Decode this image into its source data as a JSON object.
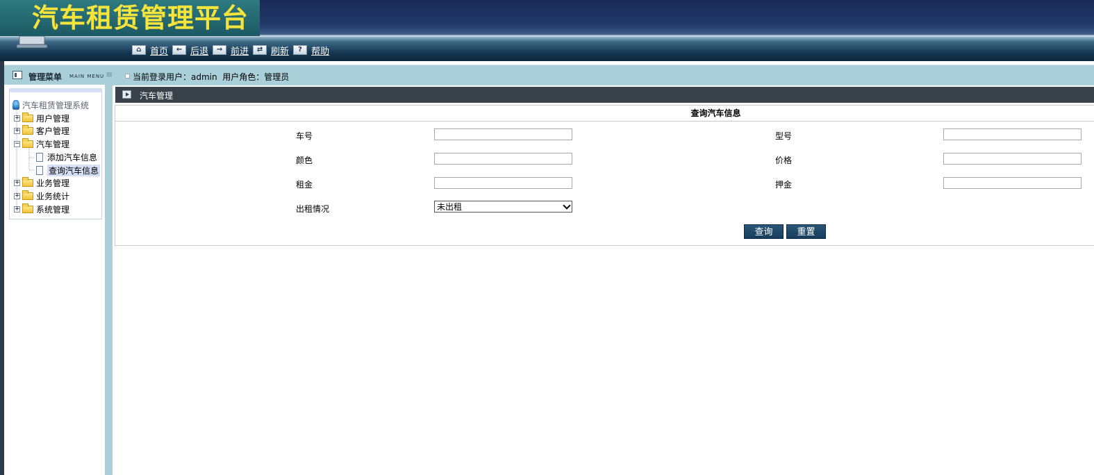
{
  "header": {
    "app_title": "汽车租赁管理平台"
  },
  "toolbar": {
    "items": [
      {
        "icon": "home-icon",
        "label": "首页"
      },
      {
        "icon": "back-arrow-icon",
        "label": "后退"
      },
      {
        "icon": "forward-arrow-icon",
        "label": "前进"
      },
      {
        "icon": "refresh-icon",
        "label": "刷新"
      },
      {
        "icon": "help-icon",
        "label": "帮助"
      }
    ]
  },
  "infobar": {
    "menu_title": "管理菜单",
    "menu_subtitle": "MAIN MENU",
    "user_info": "当前登录用户：admin  用户角色：管理员"
  },
  "sidebar": {
    "root": "汽车租赁管理系统",
    "items": [
      {
        "label": "用户管理",
        "expanded": false
      },
      {
        "label": "客户管理",
        "expanded": false
      },
      {
        "label": "汽车管理",
        "expanded": true,
        "children": [
          {
            "label": "添加汽车信息",
            "selected": false
          },
          {
            "label": "查询汽车信息",
            "selected": true
          }
        ]
      },
      {
        "label": "业务管理",
        "expanded": false
      },
      {
        "label": "业务统计",
        "expanded": false
      },
      {
        "label": "系统管理",
        "expanded": false
      }
    ]
  },
  "panel": {
    "title": "汽车管理"
  },
  "form": {
    "title": "查询汽车信息",
    "fields": {
      "car_no": {
        "label": "车号",
        "value": ""
      },
      "model": {
        "label": "型号",
        "value": ""
      },
      "color": {
        "label": "颜色",
        "value": ""
      },
      "price": {
        "label": "价格",
        "value": ""
      },
      "rent": {
        "label": "租金",
        "value": ""
      },
      "deposit": {
        "label": "押金",
        "value": ""
      },
      "rent_status": {
        "label": "出租情况",
        "value": "未出租"
      }
    },
    "query_button": "查询",
    "reset_button": "重置"
  }
}
